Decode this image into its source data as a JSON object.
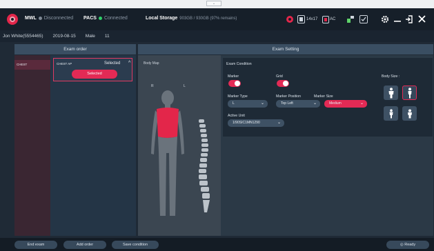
{
  "window": {
    "handle_text": "⌄"
  },
  "header": {
    "mwl_label": "MWL",
    "mwl_status": "Disconnected",
    "mwl_color": "#7f8a96",
    "pacs_label": "PACS",
    "pacs_status": "Connected",
    "pacs_color": "#2fd06a",
    "storage_label": "Local Storage",
    "storage_value": "903GB / 930GB (97% remains)",
    "detector_size": "14x17",
    "power_label": "AC"
  },
  "patient": {
    "name_id": "Jon White(5554465)",
    "date": "2019-08-15",
    "sex": "Male",
    "age": "11"
  },
  "columns": {
    "exam_order": "Exam order",
    "exam_setting": "Exam Setting"
  },
  "exam_order": {
    "category": "CHEST",
    "item_name": "CHEST AP",
    "item_status": "Selected",
    "selected_button": "Selected"
  },
  "body_map": {
    "title": "Body Map",
    "right_marker": "R",
    "left_marker": "L"
  },
  "exam_condition": {
    "title": "Exam Condition",
    "marker_label": "Marker",
    "marker_on": true,
    "grid_label": "Grid",
    "grid_on": true,
    "marker_type_label": "Marker Type",
    "marker_type_value": "L",
    "marker_position_label": "Marker Position",
    "marker_position_value": "Top Left",
    "marker_size_label": "Marker Size",
    "marker_size_value": "Medium",
    "active_unit_label": "Active Unit",
    "active_unit_value": "1/90SIC1MN1290",
    "body_size_label": "Body Size :"
  },
  "footer": {
    "end_exam": "End exam",
    "add_order": "Add order",
    "save_condition": "Save condition",
    "ready": "Ready"
  },
  "colors": {
    "accent": "#e32a55",
    "panel": "#243546",
    "header": "#161f29"
  }
}
